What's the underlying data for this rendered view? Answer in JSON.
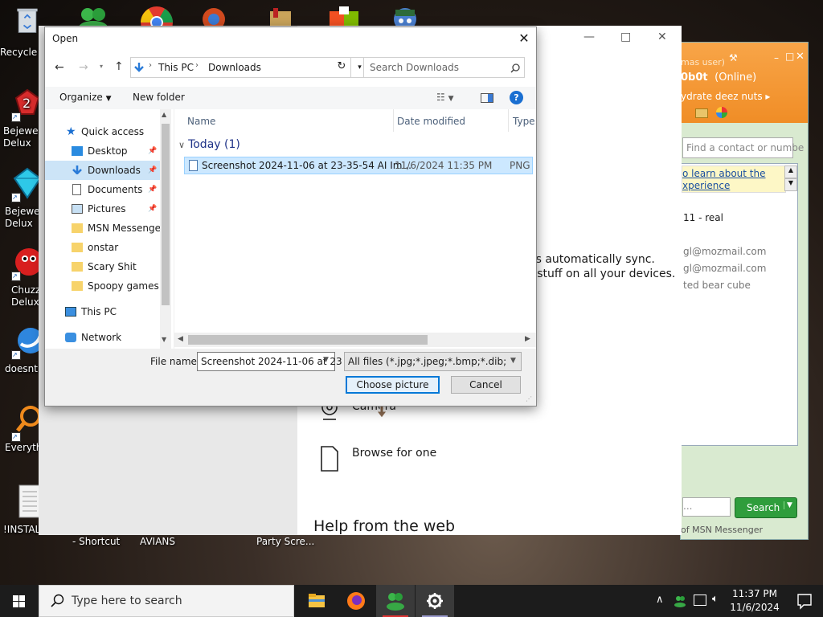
{
  "desktop": {
    "icons": [
      {
        "label": "Recycle"
      },
      {
        "label": "Bejewel Delux"
      },
      {
        "label": "Bejewe Delux"
      },
      {
        "label": "Chuzz Delux"
      },
      {
        "label": "doesnt"
      },
      {
        "label": "Everyth"
      },
      {
        "label": "!INSTALL"
      }
    ],
    "bottom_labels": [
      "- Shortcut",
      "AVIANS",
      "Party Scre..."
    ]
  },
  "settings_window": {
    "sync_text_1": "es automatically sync.",
    "sync_text_2": "r stuff on all your devices.",
    "camera_label": "Camera",
    "browse_label": "Browse for one",
    "help_heading": "Help from the web"
  },
  "msn": {
    "header_user": "mas user)",
    "header_name": "0b0t",
    "header_status": "(Online)",
    "header_message": "ydrate deez nuts",
    "find_placeholder": "Find a contact or numbe",
    "banner_link_1": "o learn about the",
    "banner_link_2": "xperience",
    "contacts": [
      "11 - real",
      "gl@mozmail.com",
      "gl@mozmail.com",
      "ted bear cube"
    ],
    "search_button": "Search",
    "footer": "of MSN Messenger"
  },
  "dialog": {
    "title": "Open",
    "breadcrumb": [
      "This PC",
      "Downloads"
    ],
    "search_placeholder": "Search Downloads",
    "organize_label": "Organize",
    "new_folder_label": "New folder",
    "nav_items": [
      {
        "label": "Quick access",
        "pinned": false
      },
      {
        "label": "Desktop",
        "pinned": true
      },
      {
        "label": "Downloads",
        "pinned": true,
        "selected": true
      },
      {
        "label": "Documents",
        "pinned": true
      },
      {
        "label": "Pictures",
        "pinned": true
      },
      {
        "label": "MSN Messenger",
        "pinned": false
      },
      {
        "label": "onstar",
        "pinned": false
      },
      {
        "label": "Scary Shit",
        "pinned": false
      },
      {
        "label": "Spoopy games",
        "pinned": false
      },
      {
        "label": "This PC",
        "pinned": false
      },
      {
        "label": "Network",
        "pinned": false
      }
    ],
    "columns": [
      "Name",
      "Date modified",
      "Type"
    ],
    "group_label": "Today (1)",
    "files": [
      {
        "name": "Screenshot 2024-11-06 at 23-35-54 AI Im...",
        "date": "11/6/2024 11:35 PM",
        "type": "PNG"
      }
    ],
    "filename_label": "File name:",
    "filename_value": "Screenshot 2024-11-06 at 23",
    "filetype_value": "All files (*.jpg;*.jpeg;*.bmp;*.dib;*.png",
    "choose_button": "Choose picture",
    "cancel_button": "Cancel"
  },
  "taskbar": {
    "search_placeholder": "Type here to search",
    "time": "11:37 PM",
    "date": "11/6/2024"
  }
}
